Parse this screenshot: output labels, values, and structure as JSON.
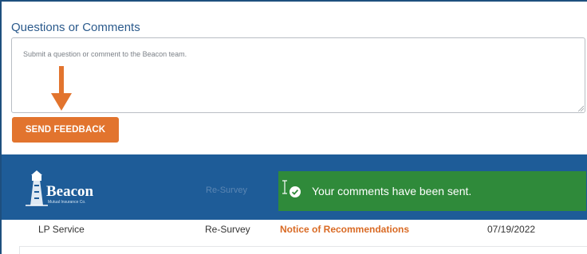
{
  "feedback": {
    "title": "Questions or Comments",
    "placeholder": "Submit a question or comment to the Beacon team.",
    "send_label": "SEND FEEDBACK"
  },
  "branding": {
    "name": "Beacon",
    "subtitle": "Mutual Insurance Co."
  },
  "background_row": {
    "type": "Re-Survey"
  },
  "toast": {
    "message": "Your comments have been sent."
  },
  "table": {
    "rows": [
      {
        "service": "LP Service",
        "type": "Re-Survey",
        "document": "Notice of Recommendations",
        "date": "07/19/2022"
      }
    ]
  },
  "colors": {
    "accent": "#e2742e",
    "header_blue": "#1e5c98",
    "success_green": "#2f8a3a",
    "title_blue": "#2b5a8c"
  },
  "icons": [
    "arrow-down-icon",
    "lighthouse-logo-icon",
    "text-cursor-icon",
    "check-circle-icon",
    "resize-grip-icon"
  ]
}
